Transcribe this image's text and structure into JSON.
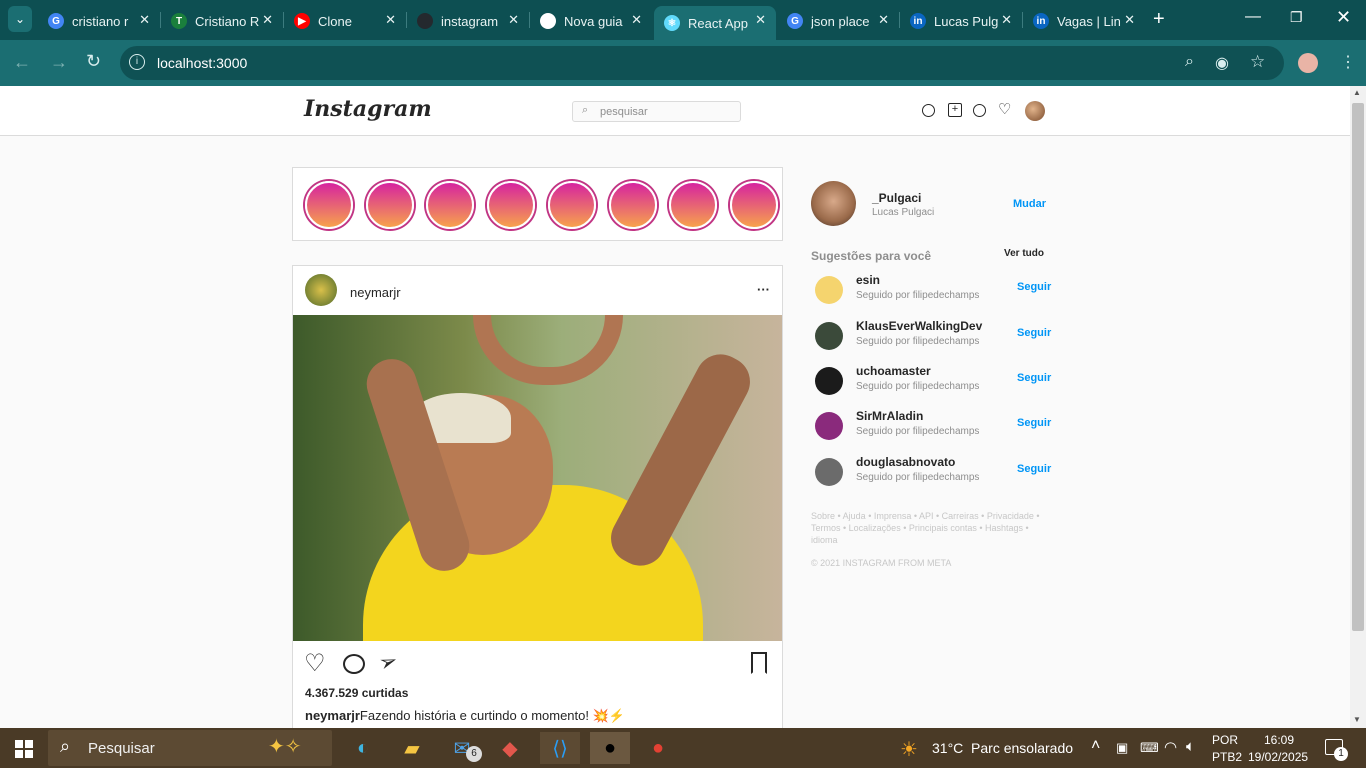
{
  "browser": {
    "tabs": [
      {
        "title": "cristiano r",
        "favicon": "google-icon",
        "color": "#4285f4",
        "glyph": "G"
      },
      {
        "title": "Cristiano R",
        "favicon": "t-icon",
        "color": "#1a7f3c",
        "glyph": "T"
      },
      {
        "title": "Clone",
        "favicon": "youtube-icon",
        "color": "#ff0000",
        "glyph": "▶"
      },
      {
        "title": "instagram",
        "favicon": "github-icon",
        "color": "#24292e",
        "glyph": ""
      },
      {
        "title": "Nova guia",
        "favicon": "chrome-icon",
        "color": "#ffffff",
        "glyph": ""
      },
      {
        "title": "React App",
        "favicon": "react-icon",
        "color": "#61dafb",
        "glyph": "⚛"
      },
      {
        "title": "json place",
        "favicon": "google-icon",
        "color": "#4285f4",
        "glyph": "G"
      },
      {
        "title": "Lucas Pulg",
        "favicon": "linkedin-icon",
        "color": "#0a66c2",
        "glyph": "in"
      },
      {
        "title": "Vagas | Lin",
        "favicon": "linkedin-icon",
        "color": "#0a66c2",
        "glyph": "in"
      }
    ],
    "url": "localhost:3000"
  },
  "instagram": {
    "logo": "Instagram",
    "search_placeholder": "pesquisar"
  },
  "post": {
    "username": "neymarjr",
    "more": "···",
    "likes": "4.367.529 curtidas",
    "caption_user": "neymarjr",
    "caption_text": "Fazendo história e curtindo o momento! 💥⚡"
  },
  "profile": {
    "username": "_Pulgaci",
    "fullname": "Lucas Pulgaci",
    "switch_label": "Mudar"
  },
  "suggestions": {
    "title": "Sugestões para você",
    "see_all": "Ver tudo",
    "follow_label": "Seguir",
    "items": [
      {
        "name": "esin",
        "sub": "Seguido por filipedechamps",
        "avatar_color": "#f5d46e"
      },
      {
        "name": "KlausEverWalkingDev",
        "sub": "Seguido por filipedechamps",
        "avatar_color": "#3b4a3a"
      },
      {
        "name": "uchoamaster",
        "sub": "Seguido por filipedechamps",
        "avatar_color": "#1b1b1b"
      },
      {
        "name": "SirMrAladin",
        "sub": "Seguido por filipedechamps",
        "avatar_color": "#8a2a7c"
      },
      {
        "name": "douglasabnovato",
        "sub": "Seguido por filipedechamps",
        "avatar_color": "#6b6b6b"
      }
    ]
  },
  "footer": {
    "links": "Sobre • Ajuda • Imprensa • API • Carreiras • Privacidade • Termos • Localizações • Principais contas • Hashtags • idioma",
    "copyright": "© 2021 INSTAGRAM FROM META"
  },
  "taskbar": {
    "search_label": "Pesquisar",
    "weather": "31°C  Parc ensolarado",
    "lang_1": "POR",
    "lang_2": "PTB2",
    "time": "16:09",
    "date": "19/02/2025",
    "notif_count": "1",
    "mail_badge": "6"
  }
}
